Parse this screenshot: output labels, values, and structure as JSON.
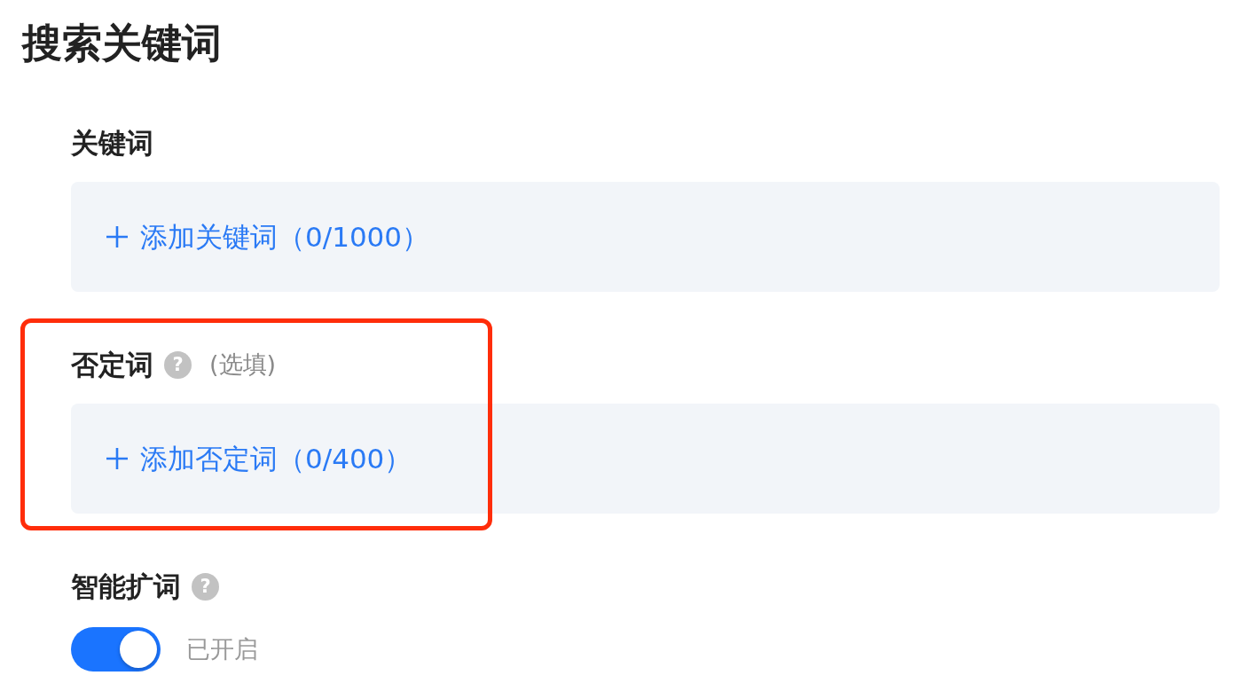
{
  "title": "搜索关键词",
  "sections": [
    {
      "kind": "word_list",
      "label": "关键词",
      "add_button": "添加关键词（0/1000）",
      "highlighted": false
    },
    {
      "kind": "word_list",
      "label": "否定词",
      "help": "?",
      "note": "(选填)",
      "add_button": "添加否定词（0/400）",
      "highlighted": true
    },
    {
      "kind": "switch",
      "label": "智能扩词",
      "help": "?",
      "on": true,
      "status": "已开启",
      "highlighted": false
    }
  ]
}
